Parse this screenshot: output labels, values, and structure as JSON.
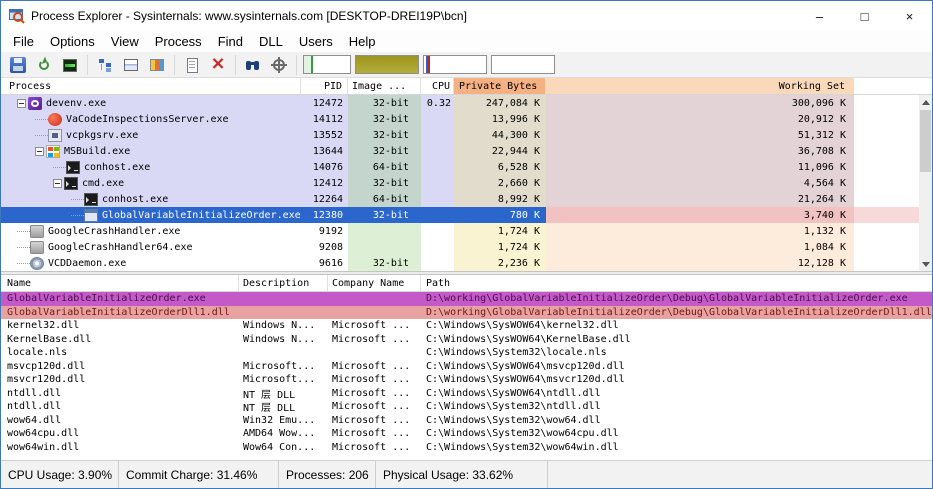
{
  "window": {
    "title": "Process Explorer - Sysinternals: www.sysinternals.com [DESKTOP-DREI19P\\bcn]",
    "controls": {
      "minimize": "–",
      "maximize": "□",
      "close": "×"
    }
  },
  "menu": {
    "items": [
      "File",
      "Options",
      "View",
      "Process",
      "Find",
      "DLL",
      "Users",
      "Help"
    ]
  },
  "toolbar": {
    "button_groups": [
      [
        "save",
        "refresh",
        "system-information"
      ],
      [
        "process-tree",
        "lower-pane",
        "view-dlls"
      ],
      [
        "properties",
        "kill-process"
      ],
      [
        "find-handle-dll",
        "find-window"
      ]
    ],
    "graphs": [
      "cpu",
      "commit",
      "io",
      "gpu"
    ]
  },
  "process_table": {
    "columns": [
      "Process",
      "PID",
      "Image ...",
      "CPU",
      "Private Bytes",
      "Working Set"
    ],
    "rows": [
      {
        "name": "devenv.exe",
        "pid": "12472",
        "image": "32-bit",
        "cpu": "0.32",
        "private_bytes": "247,084 K",
        "working_set": "300,096 K",
        "depth": 0,
        "has_children": true,
        "icon": "visual-studio",
        "style": "lavender"
      },
      {
        "name": "VaCodeInspectionsServer.exe",
        "pid": "14112",
        "image": "32-bit",
        "cpu": "",
        "private_bytes": "13,996 K",
        "working_set": "20,912 K",
        "depth": 1,
        "has_children": false,
        "icon": "va-server",
        "style": "lavender"
      },
      {
        "name": "vcpkgsrv.exe",
        "pid": "13552",
        "image": "32-bit",
        "cpu": "",
        "private_bytes": "44,300 K",
        "working_set": "51,312 K",
        "depth": 1,
        "has_children": false,
        "icon": "vcpkg",
        "style": "lavender"
      },
      {
        "name": "MSBuild.exe",
        "pid": "13644",
        "image": "32-bit",
        "cpu": "",
        "private_bytes": "22,944 K",
        "working_set": "36,708 K",
        "depth": 1,
        "has_children": true,
        "icon": "msbuild",
        "style": "lavender"
      },
      {
        "name": "conhost.exe",
        "pid": "14076",
        "image": "64-bit",
        "cpu": "",
        "private_bytes": "6,528 K",
        "working_set": "11,096 K",
        "depth": 2,
        "has_children": false,
        "icon": "console",
        "style": "lavender"
      },
      {
        "name": "cmd.exe",
        "pid": "12412",
        "image": "32-bit",
        "cpu": "",
        "private_bytes": "2,660 K",
        "working_set": "4,564 K",
        "depth": 2,
        "has_children": true,
        "icon": "console",
        "style": "lavender"
      },
      {
        "name": "conhost.exe",
        "pid": "12264",
        "image": "64-bit",
        "cpu": "",
        "private_bytes": "8,992 K",
        "working_set": "21,264 K",
        "depth": 3,
        "has_children": false,
        "icon": "console",
        "style": "lavender"
      },
      {
        "name": "GlobalVariableInitializeOrder.exe",
        "pid": "12380",
        "image": "32-bit",
        "cpu": "",
        "private_bytes": "780 K",
        "working_set": "3,740 K",
        "depth": 3,
        "has_children": false,
        "icon": "app-window",
        "style": "selected"
      },
      {
        "name": "GoogleCrashHandler.exe",
        "pid": "9192",
        "image": "",
        "cpu": "",
        "private_bytes": "1,724 K",
        "working_set": "1,132 K",
        "depth": 0,
        "has_children": false,
        "icon": "crash-handler",
        "style": "white"
      },
      {
        "name": "GoogleCrashHandler64.exe",
        "pid": "9208",
        "image": "",
        "cpu": "",
        "private_bytes": "1,724 K",
        "working_set": "1,084 K",
        "depth": 0,
        "has_children": false,
        "icon": "crash-handler",
        "style": "white"
      },
      {
        "name": "VCDDaemon.exe",
        "pid": "9616",
        "image": "32-bit",
        "cpu": "",
        "private_bytes": "2,236 K",
        "working_set": "12,128 K",
        "depth": 0,
        "has_children": false,
        "icon": "vcd",
        "style": "white"
      }
    ]
  },
  "dll_table": {
    "columns": [
      "Name",
      "Description",
      "Company Name",
      "Path"
    ],
    "rows": [
      {
        "name": "GlobalVariableInitializeOrder.exe",
        "description": "",
        "company": "",
        "path": "D:\\working\\GlobalVariableInitializeOrder\\Debug\\GlobalVariableInitializeOrder.exe",
        "style": "purple"
      },
      {
        "name": "GlobalVariableInitializeOrderDll1.dll",
        "description": "",
        "company": "",
        "path": "D:\\working\\GlobalVariableInitializeOrder\\Debug\\GlobalVariableInitializeOrderDll1.dll",
        "style": "pink"
      },
      {
        "name": "kernel32.dll",
        "description": "Windows N...",
        "company": "Microsoft ...",
        "path": "C:\\Windows\\SysWOW64\\kernel32.dll",
        "style": "plain"
      },
      {
        "name": "KernelBase.dll",
        "description": "Windows N...",
        "company": "Microsoft ...",
        "path": "C:\\Windows\\SysWOW64\\KernelBase.dll",
        "style": "plain"
      },
      {
        "name": "locale.nls",
        "description": "",
        "company": "",
        "path": "C:\\Windows\\System32\\locale.nls",
        "style": "plain"
      },
      {
        "name": "msvcp120d.dll",
        "description": "Microsoft...",
        "company": "Microsoft ...",
        "path": "C:\\Windows\\SysWOW64\\msvcp120d.dll",
        "style": "plain"
      },
      {
        "name": "msvcr120d.dll",
        "description": "Microsoft...",
        "company": "Microsoft ...",
        "path": "C:\\Windows\\SysWOW64\\msvcr120d.dll",
        "style": "plain"
      },
      {
        "name": "ntdll.dll",
        "description": "NT 层 DLL",
        "company": "Microsoft ...",
        "path": "C:\\Windows\\SysWOW64\\ntdll.dll",
        "style": "plain"
      },
      {
        "name": "ntdll.dll",
        "description": "NT 层 DLL",
        "company": "Microsoft ...",
        "path": "C:\\Windows\\System32\\ntdll.dll",
        "style": "plain"
      },
      {
        "name": "wow64.dll",
        "description": "Win32 Emu...",
        "company": "Microsoft ...",
        "path": "C:\\Windows\\System32\\wow64.dll",
        "style": "plain"
      },
      {
        "name": "wow64cpu.dll",
        "description": "AMD64 Wow...",
        "company": "Microsoft ...",
        "path": "C:\\Windows\\System32\\wow64cpu.dll",
        "style": "plain"
      },
      {
        "name": "wow64win.dll",
        "description": "Wow64 Con...",
        "company": "Microsoft ...",
        "path": "C:\\Windows\\System32\\wow64win.dll",
        "style": "plain"
      }
    ]
  },
  "status_bar": {
    "items": [
      "CPU Usage: 3.90%",
      "Commit Charge: 31.46%",
      "Processes: 206",
      "Physical Usage: 33.62%"
    ]
  },
  "colors": {
    "selection": "#2a66cc",
    "own_process": "#d9d9f6",
    "private_bytes_header": "#f5b183",
    "working_set_header": "#fad9bb",
    "dll_highlight_purple": "#c45ac8",
    "dll_highlight_pink": "#e9a2a2"
  }
}
